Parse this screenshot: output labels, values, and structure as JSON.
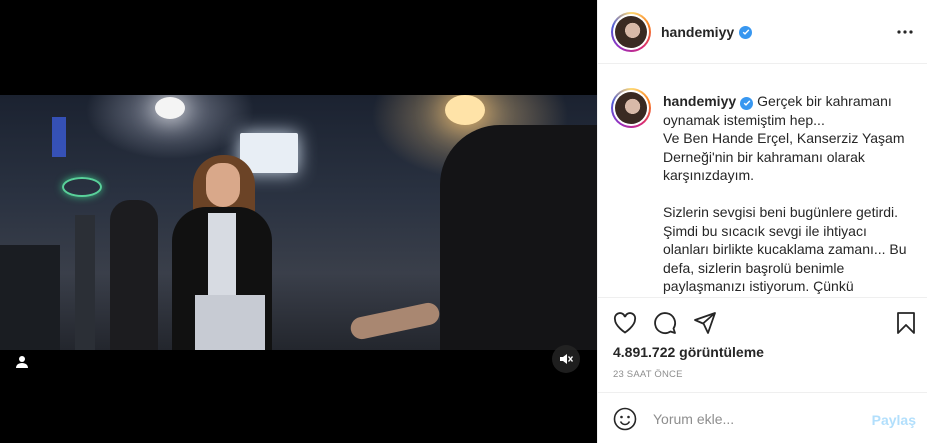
{
  "media": {
    "user_tag_icon": "user-icon",
    "mute_icon": "speaker-muted-icon"
  },
  "header": {
    "username": "handemiyy",
    "verified_icon": "verified-badge-icon",
    "more_icon": "more-options-icon"
  },
  "caption": {
    "username": "handemiyy",
    "text": "Gerçek bir kahramanı oynamak istemiştim hep...\nVe Ben Hande Erçel, Kanserziz Yaşam Derneği'nin bir kahramanı olarak karşınızdayım.\n\nSizlerin sevgisi beni bugünlere getirdi. Şimdi bu sıcacık sevgi ile ihtiyacı olanları birlikte kucaklama zamanı... Bu defa, sizlerin başrolü benimle paylaşmanızı istiyorum. Çünkü"
  },
  "actions": {
    "like_icon": "heart-icon",
    "comment_icon": "comment-icon",
    "share_icon": "share-icon",
    "save_icon": "bookmark-icon"
  },
  "stats": {
    "views": "4.891.722 görüntüleme",
    "time": "23 SAAT ÖNCE"
  },
  "comment": {
    "emoji_icon": "emoji-icon",
    "placeholder": "Yorum ekle...",
    "post_label": "Paylaş"
  },
  "colors": {
    "accent": "#3897f0",
    "post_button_disabled": "#b2dffc",
    "muted_text": "#8e8e8e"
  }
}
